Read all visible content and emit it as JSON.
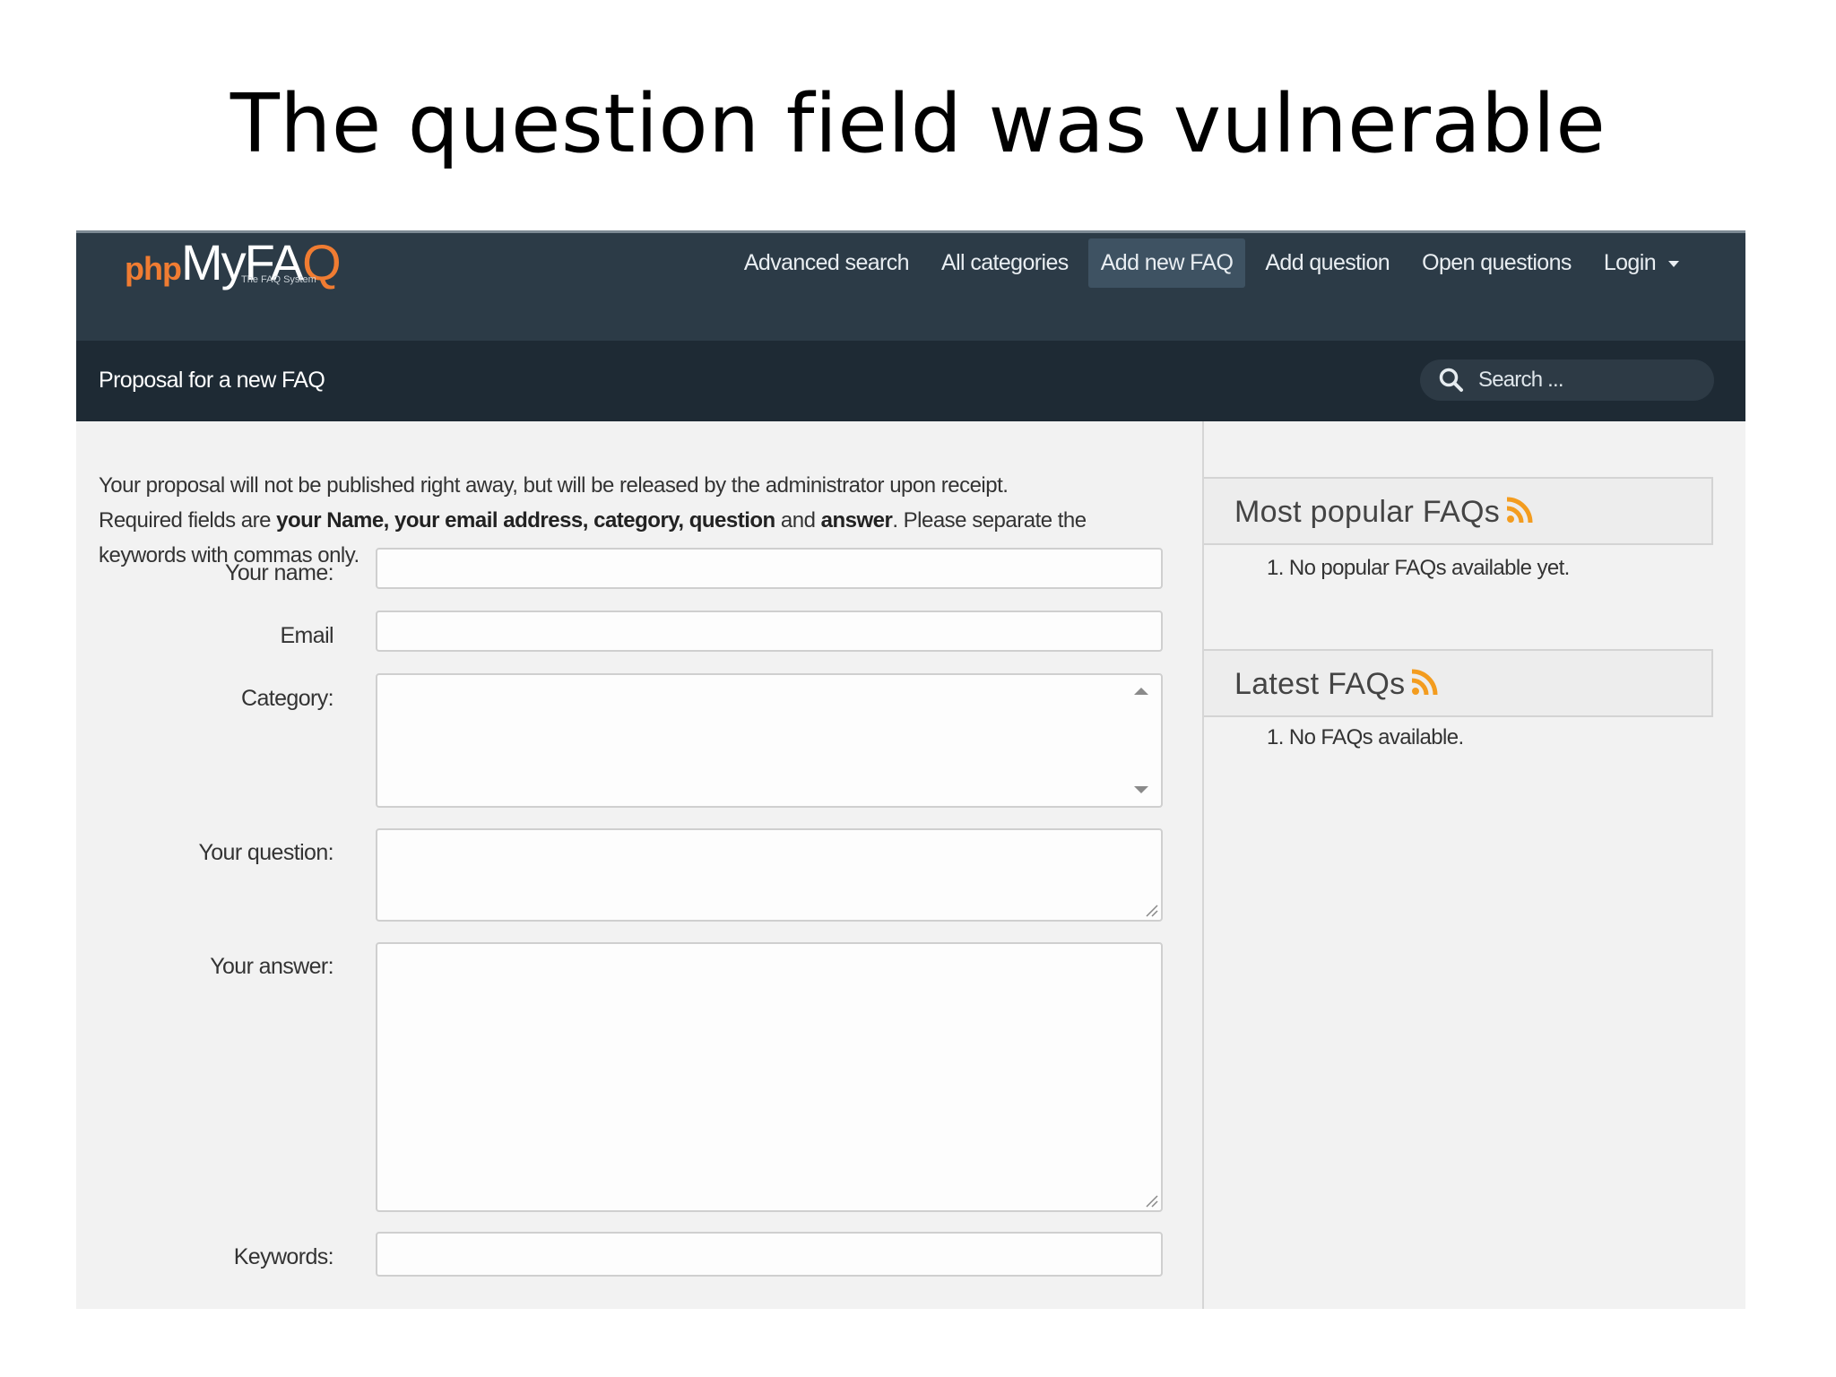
{
  "slide": {
    "title": "The question field was vulnerable"
  },
  "header": {
    "logo": {
      "php": "php",
      "my": "MyFA",
      "q": "Q",
      "tagline": "The FAQ System"
    },
    "nav": [
      {
        "label": "Advanced search",
        "active": false
      },
      {
        "label": "All categories",
        "active": false
      },
      {
        "label": "Add new FAQ",
        "active": true
      },
      {
        "label": "Add question",
        "active": false
      },
      {
        "label": "Open questions",
        "active": false
      },
      {
        "label": "Login",
        "active": false,
        "dropdown": true
      }
    ],
    "page_title": "Proposal for a new FAQ",
    "search_placeholder": "Search ..."
  },
  "form": {
    "intro_line1": "Your proposal will not be published right away, but will be released by the administrator upon receipt.",
    "intro_line2_a": "Required fields are ",
    "intro_line2_b": "your Name, your email address, category, question",
    "intro_line2_c": " and ",
    "intro_line2_d": "answer",
    "intro_line2_e": ". Please separate the",
    "intro_line3": "keywords with commas only.",
    "fields": {
      "name_label": "Your name:",
      "email_label": "Email",
      "category_label": "Category:",
      "question_label": "Your question:",
      "answer_label": "Your answer:",
      "keywords_label": "Keywords:"
    }
  },
  "sidebar": {
    "popular_title": "Most popular FAQs",
    "popular_item": "1. No popular FAQs available yet.",
    "latest_title": "Latest FAQs",
    "latest_item": "1. No FAQs available."
  },
  "colors": {
    "topbar": "#2c3b47",
    "subbar": "#1e2a34",
    "accent_orange": "#f07c32",
    "rss": "#f39c1f"
  },
  "icons": [
    "search-icon",
    "rss-icon",
    "caret-down-icon",
    "scroll-up-icon",
    "scroll-down-icon",
    "resize-grip-icon"
  ]
}
